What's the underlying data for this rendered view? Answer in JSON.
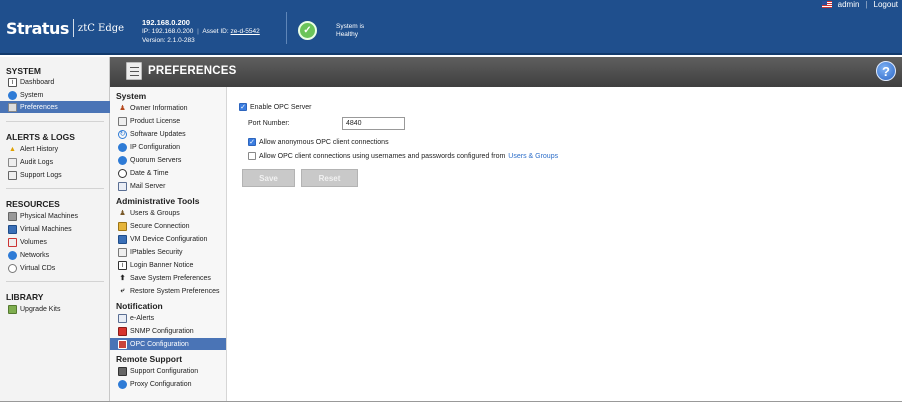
{
  "header": {
    "brand": "Stratus",
    "product": "ztC Edge",
    "ip_primary": "192.168.0.200",
    "ip_label": "IP:",
    "ip_value": "192.168.0.200",
    "asset_label": "Asset ID:",
    "asset_value": "ze-d-5542",
    "version": "Version: 2.1.0-283",
    "health_line1": "System is",
    "health_line2": "Healthy",
    "user": "admin",
    "logout": "Logout",
    "colors": {
      "header_bg": "#1f4f8d",
      "healthy": "#6ac45a"
    }
  },
  "sidebar": {
    "sections": [
      {
        "title": "SYSTEM",
        "items": [
          "Dashboard",
          "System",
          "Preferences"
        ]
      },
      {
        "title": "ALERTS & LOGS",
        "items": [
          "Alert History",
          "Audit Logs",
          "Support Logs"
        ]
      },
      {
        "title": "RESOURCES",
        "items": [
          "Physical Machines",
          "Virtual Machines",
          "Volumes",
          "Networks",
          "Virtual CDs"
        ]
      },
      {
        "title": "LIBRARY",
        "items": [
          "Upgrade Kits"
        ]
      }
    ],
    "active": "Preferences"
  },
  "page": {
    "title": "PREFERENCES",
    "help": "?"
  },
  "prefmenu": {
    "sections": [
      {
        "title": "System",
        "items": [
          "Owner Information",
          "Product License",
          "Software Updates",
          "IP Configuration",
          "Quorum Servers",
          "Date & Time",
          "Mail Server"
        ]
      },
      {
        "title": "Administrative Tools",
        "items": [
          "Users & Groups",
          "Secure Connection",
          "VM Device Configuration",
          "IPtables Security",
          "Login Banner Notice",
          "Save System Preferences",
          "Restore System Preferences"
        ]
      },
      {
        "title": "Notification",
        "items": [
          "e-Alerts",
          "SNMP Configuration",
          "OPC Configuration"
        ]
      },
      {
        "title": "Remote Support",
        "items": [
          "Support Configuration",
          "Proxy Configuration"
        ]
      }
    ],
    "active": "OPC Configuration"
  },
  "opc": {
    "enable_label": "Enable OPC Server",
    "enable_checked": true,
    "port_label": "Port Number:",
    "port_value": "4840",
    "anon_label": "Allow anonymous OPC client connections",
    "anon_checked": true,
    "auth_label": "Allow OPC client connections using usernames and passwords configured from",
    "auth_link": "Users & Groups",
    "auth_checked": false,
    "save_label": "Save",
    "reset_label": "Reset"
  }
}
